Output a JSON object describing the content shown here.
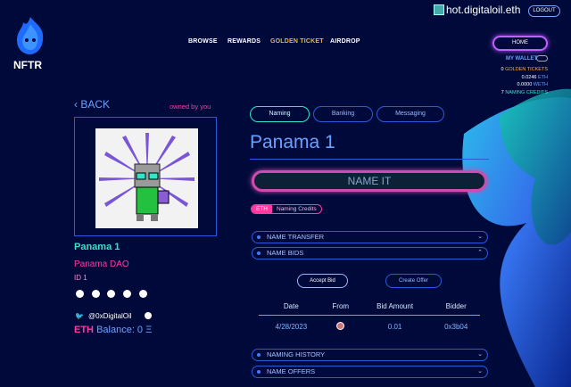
{
  "brand": {
    "name": "NFTR"
  },
  "wallet": {
    "user": "hot.digitaloil.eth",
    "logout_label": "LOGOUT"
  },
  "nav": [
    "BROWSE",
    "REWARDS",
    "GOLDEN TICKET",
    "AIRDROP"
  ],
  "home_label": "HOME",
  "my_wallet_label": "MY WALLET",
  "balances": [
    {
      "amount": "0",
      "label": "GOLDEN TICKETS"
    },
    {
      "amount": "0.0246",
      "label": "ETH"
    },
    {
      "amount": "0.0000",
      "label": "WETH"
    },
    {
      "amount": "7",
      "label": "NAMING CREDITS"
    }
  ],
  "back_label": "BACK",
  "owned_label": "owned by you",
  "nft": {
    "name": "Panama 1",
    "collection": "Panama DAO",
    "id": "ID 1",
    "twitter": "@0xDigitalOil",
    "balance_label": "ETH",
    "balance_text": "Balance: 0 Ξ"
  },
  "tabs": [
    "Naming",
    "Banking",
    "Messaging"
  ],
  "title": "Panama 1",
  "name_it_label": "NAME IT",
  "currency_toggle": [
    "ETH",
    "Naming Credits"
  ],
  "sections": {
    "transfer": "NAME TRANSFER",
    "bids": "NAME BIDS",
    "history": "NAMING HISTORY",
    "offers": "NAME OFFERS"
  },
  "buttons": {
    "accept": "Accept Bid",
    "create": "Create Offer"
  },
  "bids_table": {
    "headers": [
      "Date",
      "From",
      "Bid Amount",
      "Bidder"
    ],
    "rows": [
      {
        "date": "4/28/2023",
        "amount": "0.01",
        "bidder": "0x3b04"
      }
    ]
  },
  "colors": {
    "accent_pink": "#ff3aa0",
    "accent_teal": "#2ee6c8",
    "gold": "#f5b041",
    "bg": "#000a3a"
  }
}
